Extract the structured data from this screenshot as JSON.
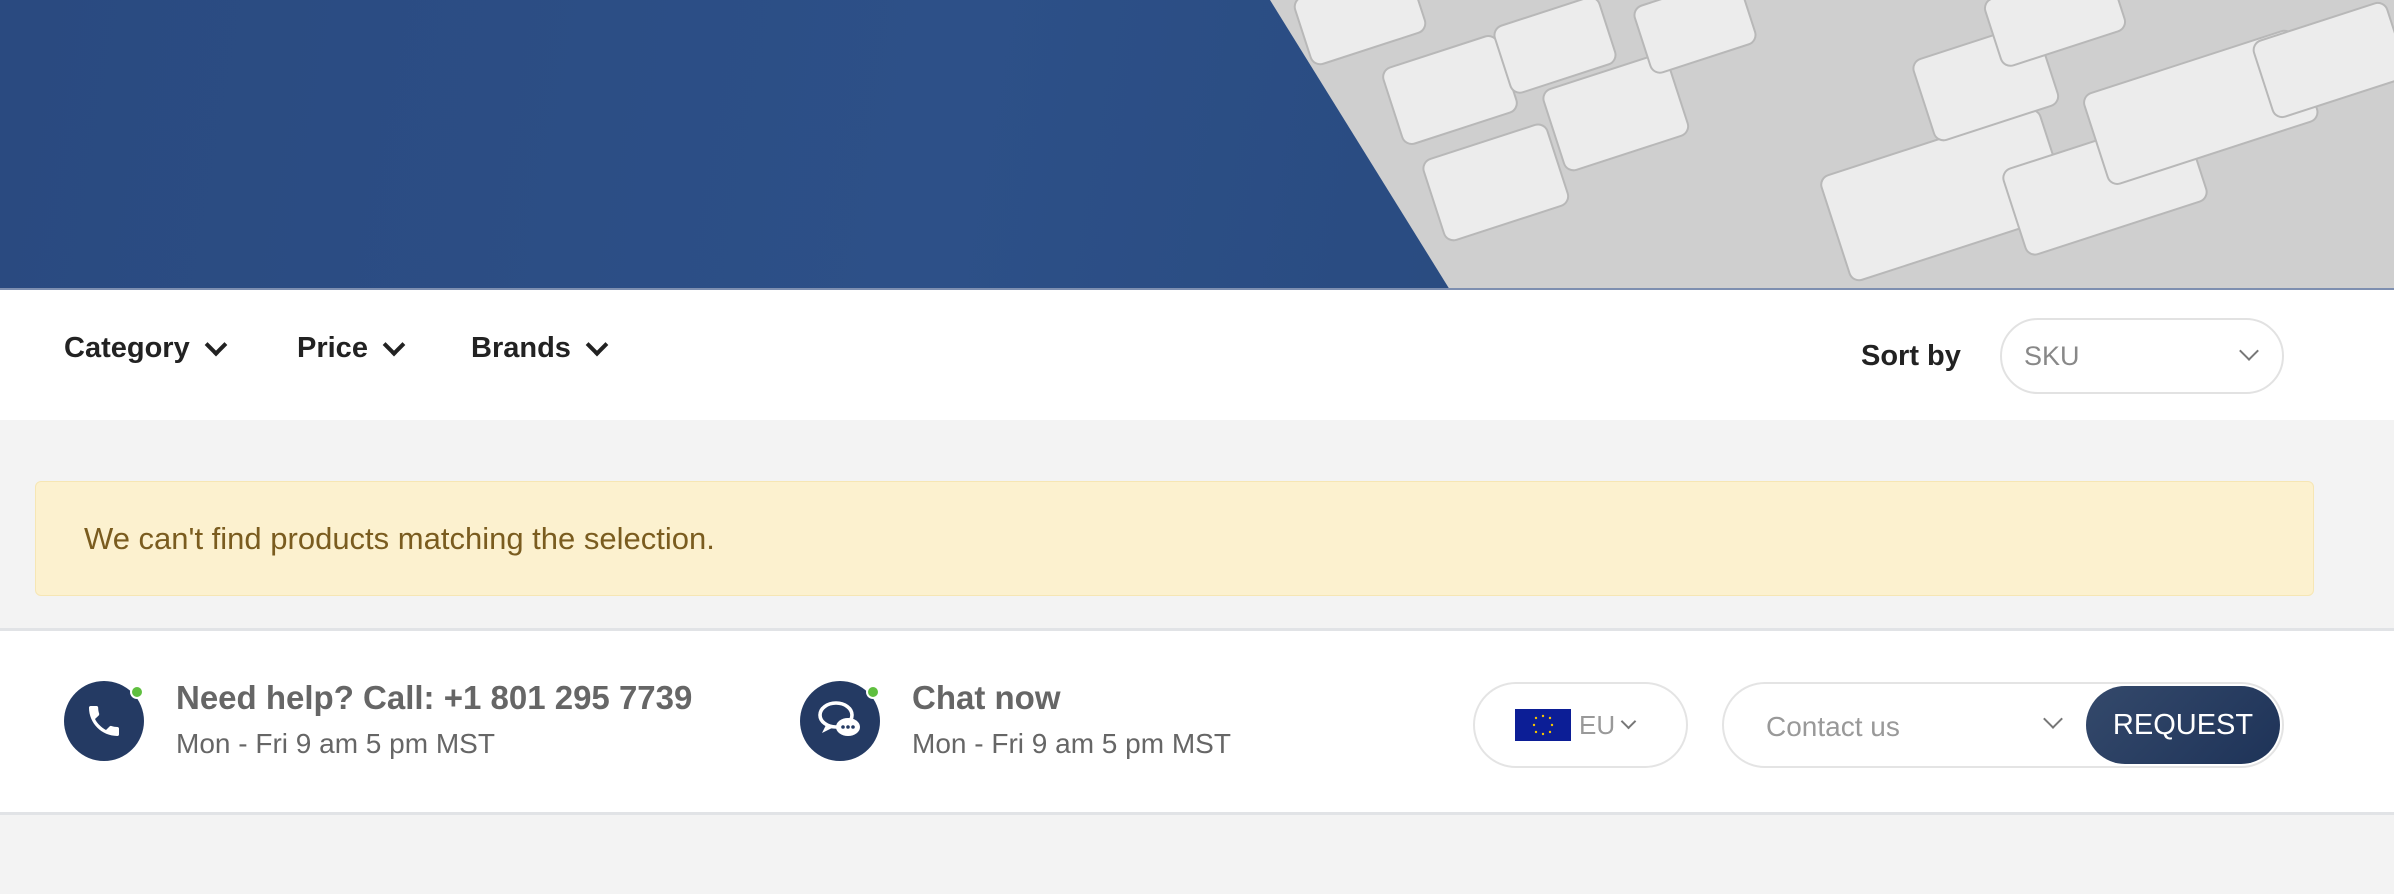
{
  "filters": {
    "items": [
      {
        "label": "Category"
      },
      {
        "label": "Price"
      },
      {
        "label": "Brands"
      }
    ],
    "sort_label": "Sort by",
    "sort_value": "SKU"
  },
  "alert": {
    "message": "We can't find products matching the selection."
  },
  "footer": {
    "phone": {
      "title": "Need help? Call: +1 801 295 7739",
      "hours": "Mon - Fri 9 am 5 pm MST",
      "icon": "phone-icon"
    },
    "chat": {
      "title": "Chat now",
      "hours": "Mon - Fri 9 am 5 pm MST",
      "icon": "chat-icon"
    },
    "region": "EU",
    "contact_value": "Contact us",
    "request_label": "REQUEST"
  },
  "colors": {
    "banner": "#2d5088",
    "alert_bg": "#fcf1cf",
    "alert_text": "#7a5c1f",
    "button": "#243a63",
    "online": "#5fbf3f"
  }
}
